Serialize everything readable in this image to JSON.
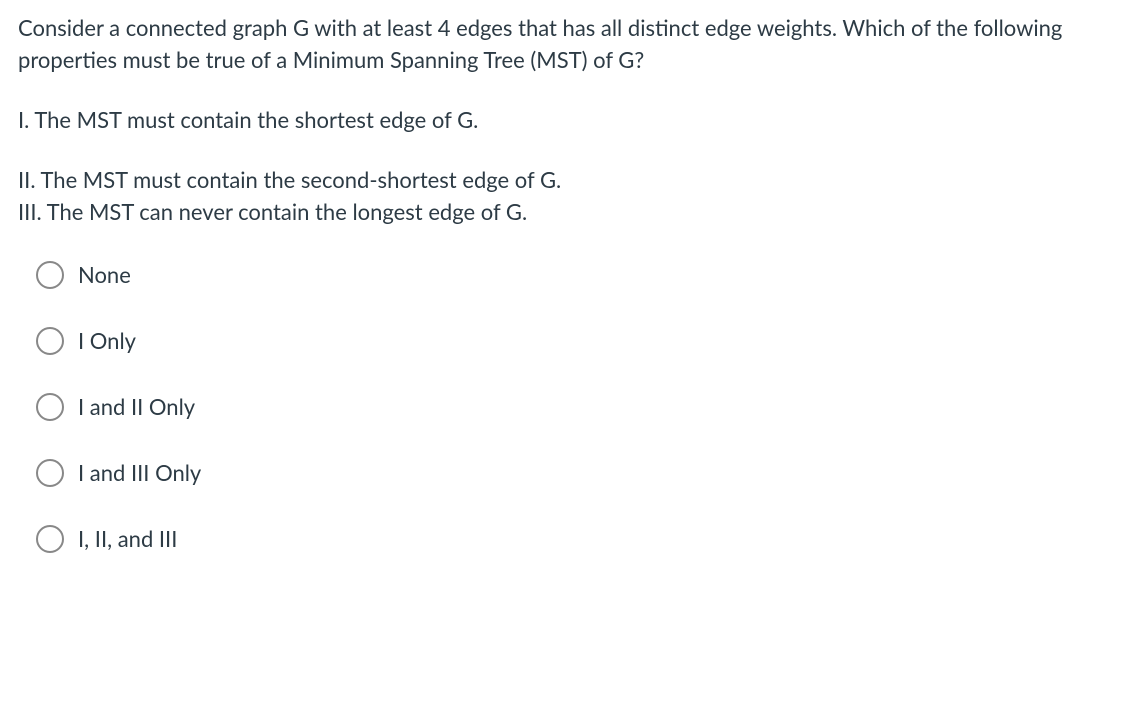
{
  "question": {
    "stem": "Consider a connected graph G with at least 4 edges that has all distinct edge weights. Which of the following properties must be true of a Minimum Spanning Tree (MST) of G?"
  },
  "statements": {
    "i": "I. The MST must contain the shortest edge of G.",
    "ii": "II. The MST must contain the second-shortest edge of G.",
    "iii": "III. The MST can never contain the longest edge of G."
  },
  "options": [
    {
      "label": "None"
    },
    {
      "label": "I Only"
    },
    {
      "label": "I and II Only"
    },
    {
      "label": "I and III Only"
    },
    {
      "label": "I, II, and III"
    }
  ]
}
